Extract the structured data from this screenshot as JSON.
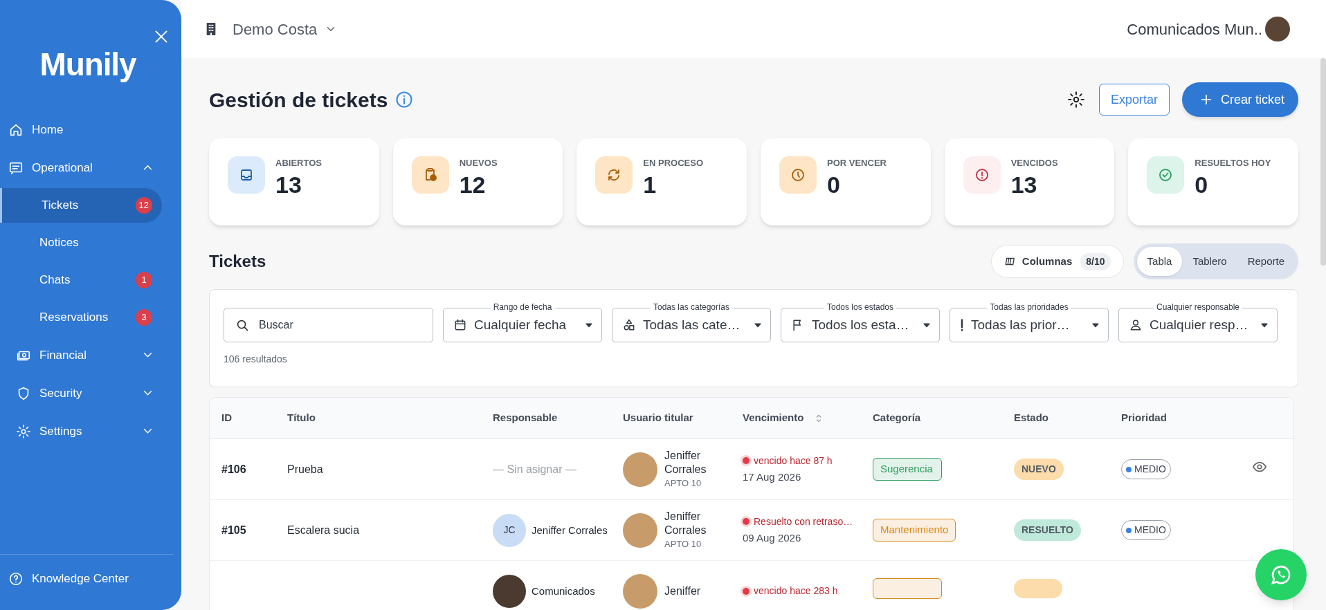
{
  "sidebar": {
    "logo": "Munily",
    "items": [
      {
        "kind": "link",
        "label": "Home"
      },
      {
        "kind": "group",
        "label": "Operational",
        "expanded": true,
        "children": [
          {
            "label": "Tickets",
            "badge": "12",
            "selected": true
          },
          {
            "label": "Notices",
            "selected": false
          },
          {
            "label": "Chats",
            "badge": "1",
            "selected": false
          },
          {
            "label": "Reservations",
            "badge": "3",
            "selected": false
          }
        ]
      },
      {
        "kind": "group",
        "label": "Financial",
        "expanded": false
      },
      {
        "kind": "group",
        "label": "Security",
        "expanded": false
      },
      {
        "kind": "group",
        "label": "Settings",
        "expanded": false
      }
    ],
    "footer": "Knowledge Center"
  },
  "header": {
    "building": "Demo Costa",
    "user": "Comunicados Mun.."
  },
  "page": {
    "title": "Gestión de tickets",
    "export": "Exportar",
    "create": "Crear ticket"
  },
  "stats": [
    {
      "label": "ABIERTOS",
      "value": "13",
      "color": "#dcebfb"
    },
    {
      "label": "NUEVOS",
      "value": "12",
      "color": "#fde5c6"
    },
    {
      "label": "EN PROCESO",
      "value": "1",
      "color": "#fde5c6"
    },
    {
      "label": "POR VENCER",
      "value": "0",
      "color": "#fde5c6"
    },
    {
      "label": "VENCIDOS",
      "value": "13",
      "color": "#fdeef0"
    },
    {
      "label": "RESUELTOS HOY",
      "value": "0",
      "color": "#dcf4ea"
    }
  ],
  "tickets": {
    "title": "Tickets",
    "columns_button": "Columnas",
    "columns_count": "8/10",
    "views": [
      {
        "label": "Tabla",
        "selected": true
      },
      {
        "label": "Tablero",
        "selected": false
      },
      {
        "label": "Reporte",
        "selected": false
      }
    ],
    "search": {
      "placeholder": "Buscar"
    },
    "filters": [
      {
        "label": "Rango de fecha",
        "value": "Cualquier fecha"
      },
      {
        "label": "Todas las categorías",
        "value": "Todas las cate…"
      },
      {
        "label": "Todos los estados",
        "value": "Todos los esta…"
      },
      {
        "label": "Todas las prioridades",
        "value": "Todas las prior…"
      },
      {
        "label": "Cualquier responsable",
        "value": "Cualquier resp…"
      }
    ],
    "results": "106 resultados",
    "table": {
      "columns": [
        {
          "label": "ID",
          "sortable": false
        },
        {
          "label": "Título",
          "sortable": false
        },
        {
          "label": "Responsable",
          "sortable": false
        },
        {
          "label": "Usuario titular",
          "sortable": false
        },
        {
          "label": "Vencimiento",
          "sortable": true
        },
        {
          "label": "Categoría",
          "sortable": false
        },
        {
          "label": "Estado",
          "sortable": false
        },
        {
          "label": "Prioridad",
          "sortable": false
        }
      ],
      "rows": [
        {
          "id": "#106",
          "title": "Prueba",
          "responsible": {
            "kind": "unassigned",
            "name": "— Sin asignar —"
          },
          "holder": {
            "name": "Jeniffer Corrales",
            "unit": "APTO 10"
          },
          "due": {
            "note": "vencido hace 87 h",
            "date": "17 Aug 2026"
          },
          "category": {
            "label": "Sugerencia",
            "color": "#2f9e62"
          },
          "status": {
            "label": "NUEVO",
            "color": "#fbdcaa"
          },
          "priority": {
            "label": "MEDIO",
            "color": "#3b82e0"
          }
        },
        {
          "id": "#105",
          "title": "Escalera sucia",
          "responsible": {
            "kind": "initials",
            "initials": "JC",
            "name": "Jeniffer Corrales"
          },
          "holder": {
            "name": "Jeniffer Corrales",
            "unit": "APTO 10"
          },
          "due": {
            "note": "Resuelto con retraso…",
            "date": "09 Aug 2026"
          },
          "category": {
            "label": "Mantenimiento",
            "color": "#d98a1c"
          },
          "status": {
            "label": "RESUELTO",
            "color": "#bfeadb"
          },
          "priority": {
            "label": "MEDIO",
            "color": "#3b82e0"
          }
        },
        {
          "responsible": {
            "kind": "photo",
            "name": "Comunicados"
          },
          "holder": {
            "name": "Jeniffer"
          },
          "due": {
            "note": "vencido hace 283 h"
          },
          "category": {
            "color": "#d98a1c"
          },
          "status": {
            "color": "#fbdcaa"
          }
        }
      ]
    }
  }
}
